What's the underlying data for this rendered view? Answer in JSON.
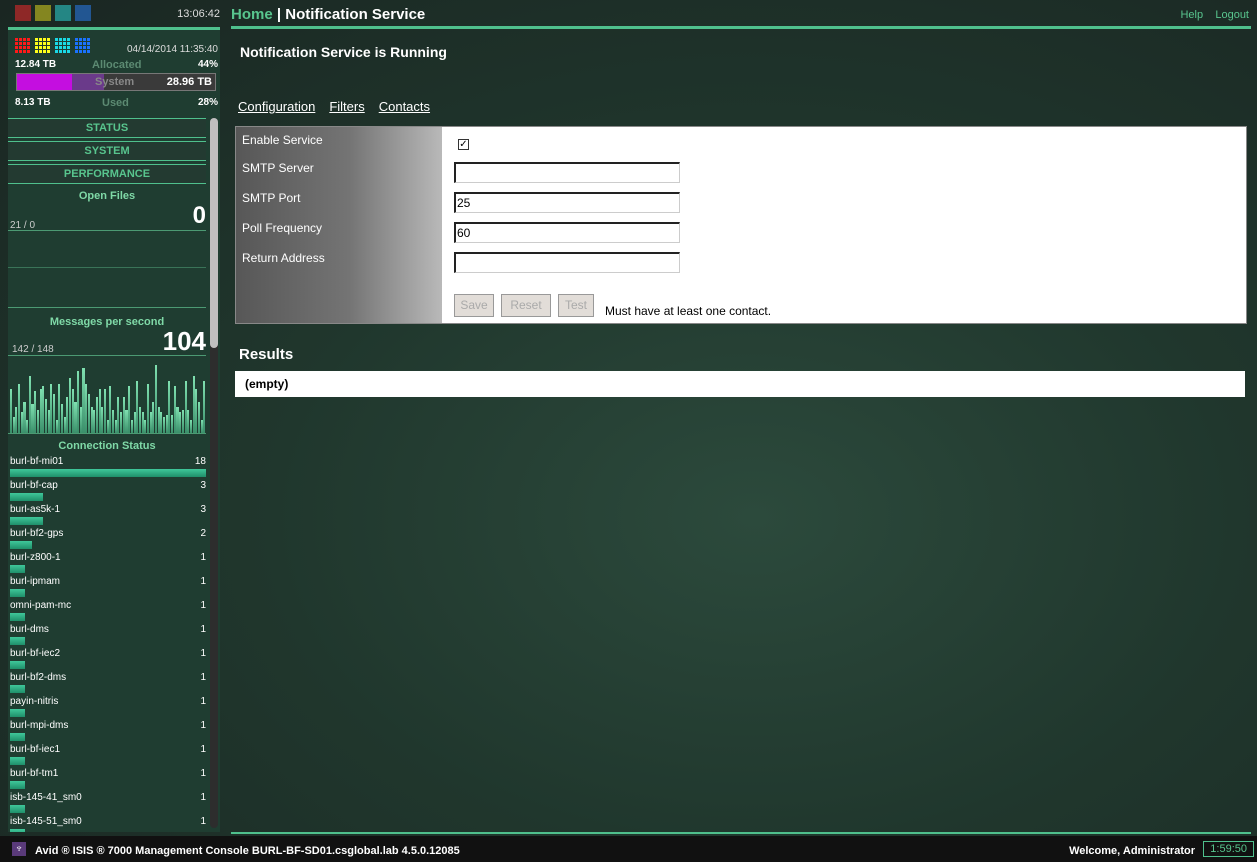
{
  "top": {
    "clock": "13:06:42",
    "colors": [
      "#b52a2a",
      "#a8a720",
      "#28a6a6",
      "#2566b8"
    ]
  },
  "storage": {
    "datetime": "04/14/2014 11:35:40",
    "allocated_size": "12.84 TB",
    "allocated_label": "Allocated",
    "allocated_pct": "44%",
    "system_label": "System",
    "system_total": "28.96 TB",
    "used_size": "8.13 TB",
    "used_label": "Used",
    "used_pct": "28%",
    "allocated_fraction": 0.44,
    "used_fraction": 0.28,
    "grid_colors": [
      "#ff1a1a",
      "#ffff1a",
      "#1ad9e6",
      "#1a73ff"
    ]
  },
  "sidebar": {
    "nav": [
      "STATUS",
      "SYSTEM",
      "PERFORMANCE"
    ],
    "open_files": {
      "title": "Open Files",
      "range": "21 / 0",
      "value": "0"
    },
    "messages": {
      "title": "Messages per second",
      "range": "142 / 148",
      "value": "104",
      "history": [
        85,
        30,
        50,
        95,
        40,
        60,
        25,
        110,
        55,
        80,
        45,
        85,
        90,
        65,
        45,
        95,
        75,
        25,
        95,
        55,
        30,
        70,
        105,
        85,
        60,
        120,
        50,
        125,
        95,
        75,
        50,
        45,
        70,
        85,
        50,
        85,
        25,
        90,
        45,
        25,
        70,
        40,
        70,
        45,
        90,
        25,
        40,
        100,
        50,
        40,
        25,
        95,
        40,
        60,
        130,
        50,
        40,
        30,
        35,
        100,
        35,
        90,
        50,
        40,
        45,
        100,
        45,
        25,
        110,
        85,
        60,
        25,
        100
      ]
    },
    "connection_title": "Connection Status",
    "connections": [
      {
        "name": "burl-bf-mi01",
        "count": 18
      },
      {
        "name": "burl-bf-cap",
        "count": 3
      },
      {
        "name": "burl-as5k-1",
        "count": 3
      },
      {
        "name": "burl-bf2-gps",
        "count": 2
      },
      {
        "name": "burl-z800-1",
        "count": 1
      },
      {
        "name": "burl-ipmam",
        "count": 1
      },
      {
        "name": "omni-pam-mc",
        "count": 1
      },
      {
        "name": "burl-dms",
        "count": 1
      },
      {
        "name": "burl-bf-iec2",
        "count": 1
      },
      {
        "name": "burl-bf2-dms",
        "count": 1
      },
      {
        "name": "payin-nitris",
        "count": 1
      },
      {
        "name": "burl-mpi-dms",
        "count": 1
      },
      {
        "name": "burl-bf-iec1",
        "count": 1
      },
      {
        "name": "burl-bf-tm1",
        "count": 1
      },
      {
        "name": "isb-145-41_sm0",
        "count": 1
      },
      {
        "name": "isb-145-51_sm0",
        "count": 1
      }
    ]
  },
  "header": {
    "home": "Home",
    "sep": " | ",
    "title": "Notification Service",
    "help": "Help",
    "logout": "Logout"
  },
  "main": {
    "status": "Notification Service is Running",
    "tabs": [
      "Configuration",
      "Filters",
      "Contacts"
    ],
    "form": {
      "enable_label": "Enable Service",
      "enabled": true,
      "smtp_server_label": "SMTP Server",
      "smtp_server": "",
      "smtp_port_label": "SMTP Port",
      "smtp_port": "25",
      "poll_label": "Poll Frequency",
      "poll": "60",
      "return_label": "Return Address",
      "return_address": "",
      "save": "Save",
      "reset": "Reset",
      "test": "Test",
      "message": "Must have at least one contact."
    },
    "results_title": "Results",
    "results_value": "(empty)"
  },
  "footer": {
    "product": "Avid ® ISIS ® 7000  Management Console  BURL-BF-SD01.csglobal.lab  4.5.0.12085",
    "welcome": "Welcome, Administrator",
    "timer": "1:59:50"
  }
}
